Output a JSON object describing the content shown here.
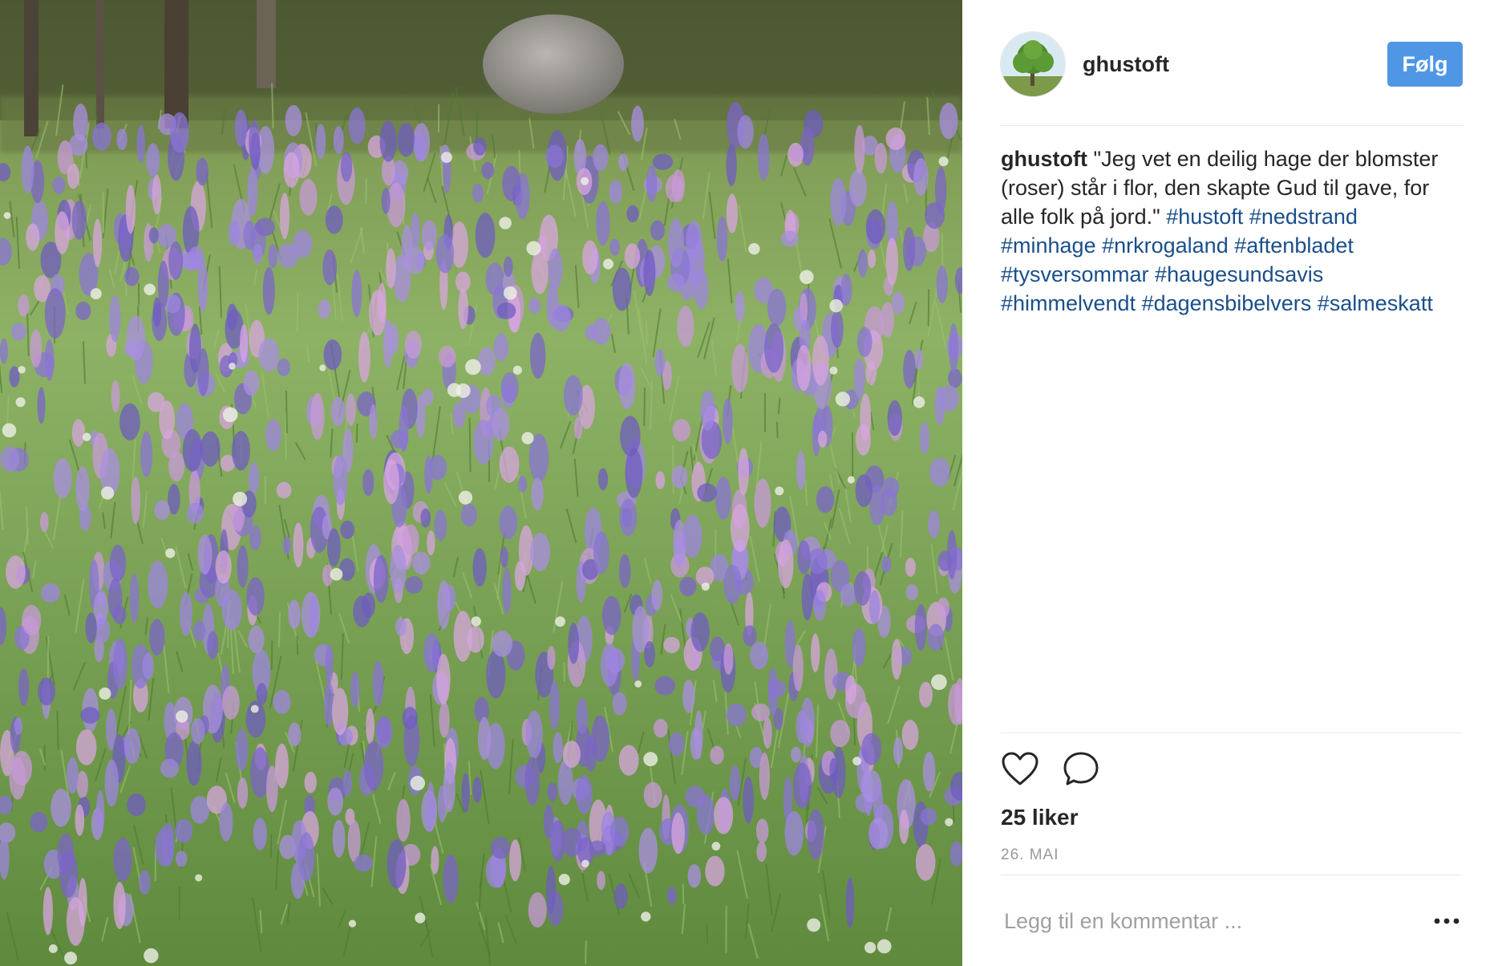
{
  "post": {
    "photo_alt": "flower meadow",
    "username": "ghustoft",
    "follow_label": "Følg",
    "caption": {
      "username": "ghustoft",
      "text": "\"Jeg vet en deilig hage der blomster (roser) står i flor, den skapte Gud til gave, for alle folk på jord.\"",
      "hashtags": [
        "#hustoft",
        "#nedstrand",
        "#minhage",
        "#nrkrogaland",
        "#aftenbladet",
        "#tysversommar",
        "#haugesundsavis",
        "#himmelvendt",
        "#dagensbibelvers",
        "#salmeskatt"
      ]
    },
    "likes": "25 liker",
    "date": "26. MAI",
    "comment_placeholder": "Legg til en kommentar ...",
    "icons": {
      "like": "heart-icon",
      "comment": "speech-bubble-icon",
      "more": "ellipsis-icon"
    },
    "colors": {
      "follow_button": "#4f97e5",
      "hashtag": "#1a4f8a",
      "date": "#999999"
    }
  }
}
